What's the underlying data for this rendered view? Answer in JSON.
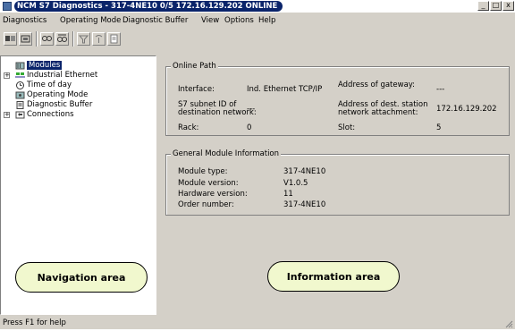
{
  "window": {
    "title": "NCM S7 Diagnostics - 317-4NE10 0/5 172.16.129.202  ONLINE",
    "controls": {
      "minimize": "_",
      "maximize": "□",
      "close": "x"
    }
  },
  "menubar": {
    "items": [
      "Diagnostics",
      "Operating Mode",
      "Diagnostic Buffer",
      "View",
      "Options",
      "Help"
    ]
  },
  "toolbar": {
    "buttons": [
      "connect-icon",
      "disconnect-icon",
      "multi-icon-a",
      "multi-icon-b",
      "filter-icon",
      "signal-icon",
      "document-icon"
    ]
  },
  "tree": {
    "items": [
      {
        "label": "Modules",
        "selected": true,
        "icon": "module-icon"
      },
      {
        "label": "Industrial Ethernet",
        "expandable": true,
        "icon": "network-icon"
      },
      {
        "label": "Time of day",
        "icon": "clock-icon"
      },
      {
        "label": "Operating Mode",
        "icon": "mode-icon"
      },
      {
        "label": "Diagnostic Buffer",
        "icon": "buffer-icon"
      },
      {
        "label": "Connections",
        "expandable": true,
        "icon": "connections-icon"
      }
    ]
  },
  "online_path": {
    "title": "Online Path",
    "interface_label": "Interface:",
    "interface_value": "Ind. Ethernet TCP/IP",
    "gateway_label": "Address of gateway:",
    "gateway_value": "---",
    "subnet_label_1": "S7 subnet ID of",
    "subnet_label_2": "destination network:",
    "subnet_value": "---",
    "dest_label_1": "Address of dest. station",
    "dest_label_2": "network attachment:",
    "dest_value": "172.16.129.202",
    "rack_label": "Rack:",
    "rack_value": "0",
    "slot_label": "Slot:",
    "slot_value": "5"
  },
  "module_info": {
    "title": "General Module Information",
    "rows": [
      {
        "label": "Module type:",
        "value": "317-4NE10"
      },
      {
        "label": "Module version:",
        "value": "V1.0.5"
      },
      {
        "label": "Hardware version:",
        "value": "11"
      },
      {
        "label": "Order number:",
        "value": "317-4NE10"
      }
    ]
  },
  "callouts": {
    "navigation": "Navigation area",
    "information": "Information area",
    "fill_color": "#f1f8ce"
  },
  "status": {
    "text": "Press F1 for help"
  },
  "colors": {
    "title_bar": "#0a246a",
    "face": "#d4d0c8",
    "selection": "#0a246a"
  }
}
